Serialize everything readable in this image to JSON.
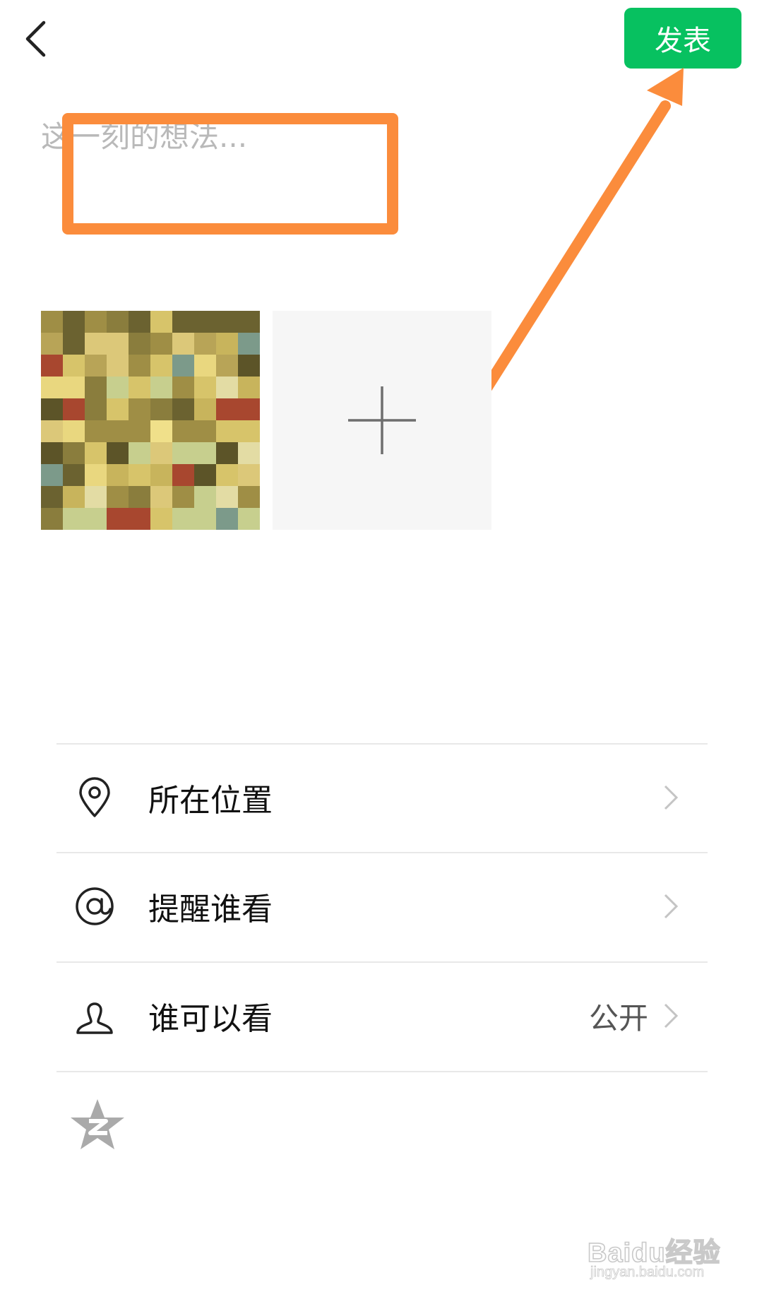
{
  "header": {
    "back_icon": "chevron-left-icon",
    "publish_label": "发表",
    "publish_color": "#07c160"
  },
  "composer": {
    "placeholder": "这一刻的想法...",
    "value": ""
  },
  "media": {
    "photo_count": 1,
    "add_icon": "plus-icon",
    "add_tile_color": "#f6f6f6"
  },
  "options": [
    {
      "icon": "location-pin-icon",
      "label": "所在位置",
      "value": ""
    },
    {
      "icon": "at-sign-icon",
      "label": "提醒谁看",
      "value": ""
    },
    {
      "icon": "person-icon",
      "label": "谁可以看",
      "value": "公开"
    }
  ],
  "share": {
    "qzone_icon": "qzone-star-icon"
  },
  "annotations": {
    "color": "#fb8c3c",
    "shapes": [
      "rectangle-around-input",
      "arrow-to-publish-button"
    ]
  },
  "watermark": {
    "brand": "Baidu经验",
    "url": "jingyan.baidu.com"
  }
}
